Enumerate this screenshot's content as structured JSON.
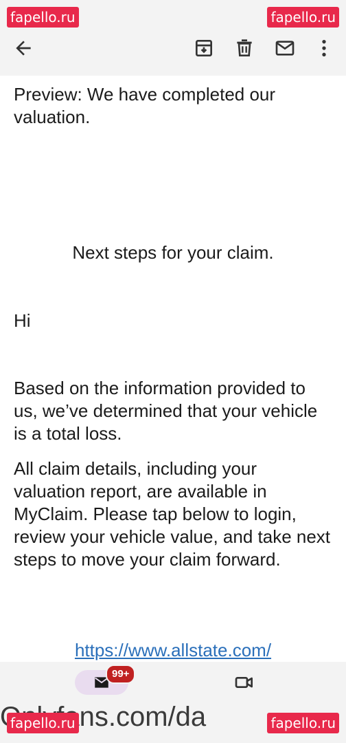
{
  "watermarks": {
    "top_left": "fapello.ru",
    "top_right": "fapello.ru",
    "bottom_left": "fapello.ru",
    "bottom_right": "fapello.ru"
  },
  "toolbar": {
    "icons": [
      "back-arrow-icon",
      "archive-icon",
      "delete-icon",
      "mark-unread-icon",
      "more-vert-icon"
    ]
  },
  "email": {
    "preview": "Preview: We have completed our valuation.",
    "heading": "Next steps for your claim.",
    "greeting": "Hi",
    "para1": "Based on the information provided to us, we’ve determined that your vehicle is a total loss.",
    "para2": "All claim details, including your valuation report, are available in MyClaim. Please tap below to login, review your vehicle value, and take next steps to move your claim forward.",
    "link": "https://www.allstate.com/"
  },
  "bottom_nav": {
    "mail_badge": "99+",
    "icons": [
      "mail-icon",
      "video-icon"
    ]
  },
  "footer_ghost": "Onlyfans.com/da"
}
